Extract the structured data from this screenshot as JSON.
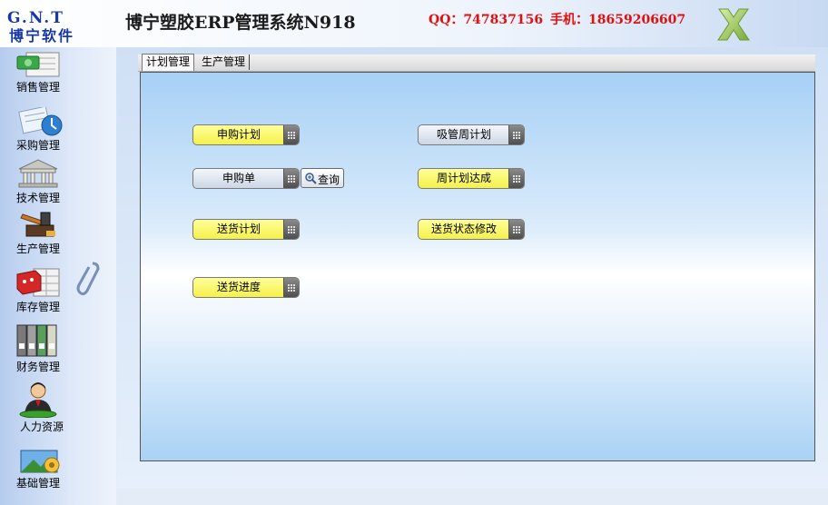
{
  "header": {
    "logo_top": "G.N.T",
    "logo_bottom": "博宁软件",
    "title": "博宁塑胶ERP管理系统N918",
    "qq": "QQ：747837156",
    "phone": "手机：18659206607"
  },
  "sidebar": {
    "items": [
      {
        "label": "销售管理",
        "icon": "sales-icon"
      },
      {
        "label": "采购管理",
        "icon": "purchase-icon"
      },
      {
        "label": "技术管理",
        "icon": "tech-icon"
      },
      {
        "label": "生产管理",
        "icon": "production-icon"
      },
      {
        "label": "库存管理",
        "icon": "inventory-icon"
      },
      {
        "label": "财务管理",
        "icon": "finance-icon"
      },
      {
        "label": "人力资源",
        "icon": "hr-icon"
      },
      {
        "label": "基础管理",
        "icon": "basic-icon"
      }
    ]
  },
  "tabs": [
    {
      "label": "计划管理",
      "active": true
    },
    {
      "label": "生产管理",
      "active": false
    }
  ],
  "functions": {
    "purchase_plan": "申购计划",
    "purchase_order": "申购单",
    "query": "查询",
    "delivery_plan": "送货计划",
    "delivery_progress": "送货进度",
    "straw_weekly_plan": "吸管周计划",
    "weekly_plan_achieved": "周计划达成",
    "delivery_status_edit": "送货状态修改"
  },
  "colors": {
    "brand": "#1838a8",
    "contact": "#e01010",
    "button_yellow": "#f4f04a",
    "button_gray": "#ccd6e4"
  }
}
